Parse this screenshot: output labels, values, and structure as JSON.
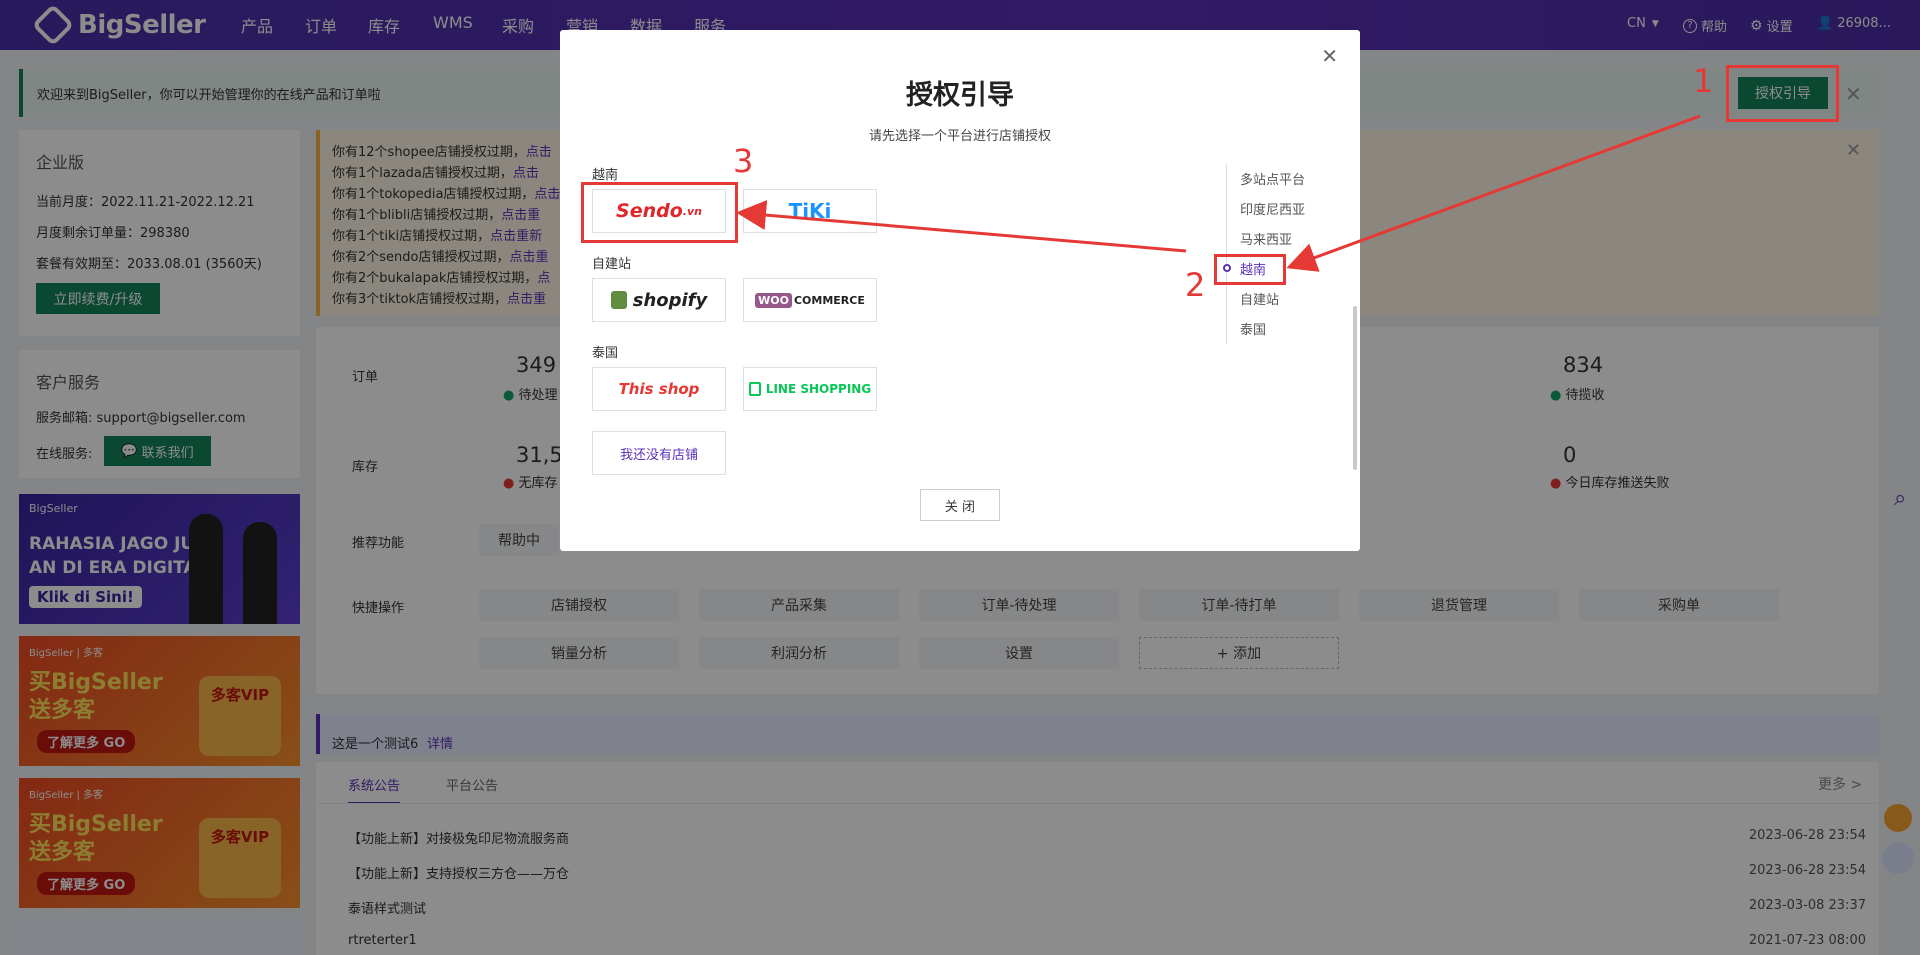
{
  "header": {
    "logo": "BigSeller",
    "nav": [
      "产品",
      "订单",
      "库存",
      "WMS",
      "采购",
      "营销",
      "数据",
      "服务"
    ],
    "lang": "CN",
    "help": "帮助",
    "settings": "设置",
    "user": "26908..."
  },
  "welcome": {
    "text": "欢迎来到BigSeller，你可以开始管理你的在线产品和订单啦",
    "guide_button": "授权引导"
  },
  "plan": {
    "title": "企业版",
    "month_label": "当前月度：",
    "month_value": "2022.11.21-2022.12.21",
    "remain_label": "月度剩余订单量：",
    "remain_value": "298380",
    "expire_label": "套餐有效期至：",
    "expire_value": "2033.08.01 (3560天)",
    "renew_button": "立即续费/升级"
  },
  "service": {
    "title": "客户服务",
    "email_label": "服务邮箱:",
    "email": "support@bigseller.com",
    "online_label": "在线服务:",
    "contact_button": "联系我们"
  },
  "banners": {
    "b1_brand": "BigSeller",
    "b1_line1": "RAHASIA JAGO JUAL",
    "b1_line2": "AN DI ERA DIGITAL",
    "b1_cta": "Klik di Sini!",
    "b2_brand": "BigSeller | 多客",
    "b2_line1": "买BigSeller",
    "b2_line2": "送多客",
    "b2_cta": "了解更多 GO",
    "b2_vip": "多客VIP"
  },
  "alerts": [
    {
      "text": "你有12个shopee店铺授权过期，",
      "link": "点击"
    },
    {
      "text": "你有1个lazada店铺授权过期，",
      "link": "点击"
    },
    {
      "text": "你有1个tokopedia店铺授权过期，",
      "link": "点击"
    },
    {
      "text": "你有1个blibli店铺授权过期，",
      "link": "点击重"
    },
    {
      "text": "你有1个tiki店铺授权过期，",
      "link": "点击重新"
    },
    {
      "text": "你有2个sendo店铺授权过期，",
      "link": "点击重"
    },
    {
      "text": "你有2个bukalapak店铺授权过期，",
      "link": "点"
    },
    {
      "text": "你有3个tiktok店铺授权过期，",
      "link": "点击重"
    }
  ],
  "dashboard": {
    "orders_label": "订单",
    "orders_value": "349",
    "orders_status": "待处理",
    "orders_right_value": "834",
    "orders_right_status": "待揽收",
    "stock_label": "库存",
    "stock_value": "31,5",
    "stock_status": "无库存",
    "stock_right_value": "0",
    "stock_right_status": "今日库存推送失败",
    "recommend_label": "推荐功能",
    "recommend_item": "帮助中",
    "quick_label": "快捷操作",
    "quick": [
      "店铺授权",
      "产品采集",
      "订单-待处理",
      "订单-待打单",
      "退货管理",
      "采购单",
      "销量分析",
      "利润分析",
      "设置",
      "+ 添加"
    ]
  },
  "notice": {
    "text": "这是一个测试6",
    "link": "详情"
  },
  "announcements": {
    "tabs": [
      "系统公告",
      "平台公告"
    ],
    "more": "更多 >",
    "rows": [
      {
        "title": "【功能上新】对接极兔印尼物流服务商",
        "date": "2023-06-28 23:54"
      },
      {
        "title": "【功能上新】支持授权三方仓——万仓",
        "date": "2023-06-28 23:54"
      },
      {
        "title": "泰语样式测试",
        "date": "2023-03-08 23:37"
      },
      {
        "title": "rtreterter1",
        "date": "2021-07-23 08:00"
      }
    ]
  },
  "modal": {
    "title": "授权引导",
    "subtitle": "请先选择一个平台进行店铺授权",
    "sections": {
      "vn": "越南",
      "own": "自建站",
      "th": "泰国"
    },
    "platforms": {
      "sendo": "Sendo",
      "sendo_suffix": ".vn",
      "tiki": "TiKi",
      "shopify": "shopify",
      "woo": "WOO",
      "woo_suffix": "COMMERCE",
      "thisshop": "This shop",
      "line": "LINE SHOPPING"
    },
    "no_shop": "我还没有店铺",
    "close": "关 闭",
    "anchors": [
      "多站点平台",
      "印度尼西亚",
      "马来西亚",
      "越南",
      "自建站",
      "泰国"
    ],
    "active_anchor": "越南"
  },
  "annotations": [
    "1",
    "2",
    "3"
  ],
  "colors": {
    "brand": "#4a2fa8",
    "primary_green": "#14845c",
    "annotation_red": "#e53935"
  }
}
